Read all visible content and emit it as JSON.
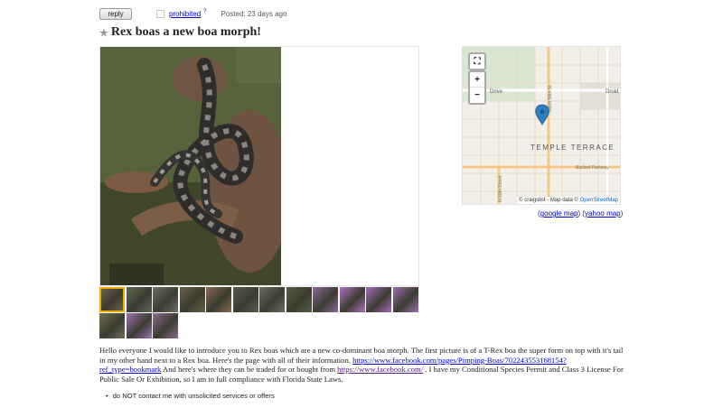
{
  "header": {
    "reply_label": "reply",
    "prohibited_label": "prohibited",
    "help_icon": "?",
    "posted_text": "Posted: 23 days ago"
  },
  "post": {
    "title": "Rex boas a new boa morph!",
    "star_icon": "★",
    "body": {
      "p1": "Hello everyone I would like to introduce you to Rex boas which are a new co-dominant boa morph. The first picture is of a T-Rex boa the super form on top with it's tail in my other hand next to a Rex boa. Here's the page with all of their information. ",
      "link1": "https://www.facebook.com/pages/Pimping-Boas/702243553168154?ref_type=bookmark",
      "p2": " And here's where they can be traded for or bought from ",
      "link2": "https://www.facebook.com/",
      "p3": " . I have my Conditional Species Permit and Class 3 License For Public Sale Or Exhibition, so I am in full compliance with Florida State Laws."
    },
    "notices": [
      "do NOT contact me with unsolicited services or offers"
    ]
  },
  "gallery": {
    "thumbnail_count": 15,
    "selected_index": 0,
    "thumb_colors": [
      "#6a6448",
      "#5f6a56",
      "#6f6e6a",
      "#6a6248",
      "#8a6a58",
      "#5a5a4e",
      "#6e6e64",
      "#556042",
      "#8e6a9e",
      "#b070c0",
      "#a96cc0",
      "#9a70b0",
      "#6f6e52",
      "#a070b8",
      "#8c6a90"
    ]
  },
  "map": {
    "labels": {
      "city": "TEMPLE TERRACE",
      "street1": "Drive",
      "street2": "Druid",
      "street3": "Burlard Parkway",
      "street4": "N 50th Street",
      "street5": "North 56th St"
    },
    "attribution_prefix": "© craigslist - Map data © ",
    "attribution_link": "OpenStreetMap",
    "zoom_in": "+",
    "zoom_out": "−",
    "fullscreen_icon": "⛶",
    "google_link": "google map",
    "yahoo_link": "yahoo map",
    "pin_color": "#2d7fc1"
  }
}
